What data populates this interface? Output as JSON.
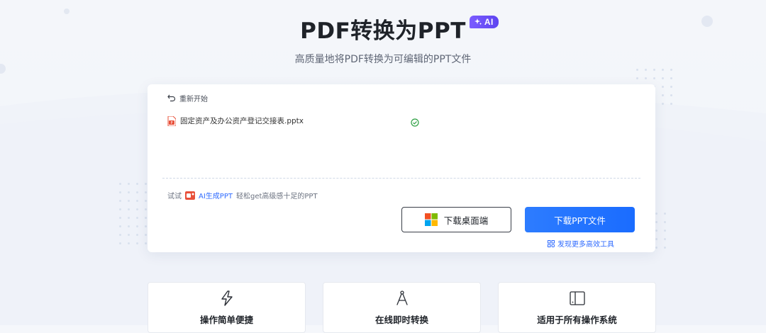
{
  "header": {
    "title": "PDF转换为PPT",
    "ai_badge": "AI",
    "subtitle": "高质量地将PDF转换为可编辑的PPT文件"
  },
  "converter": {
    "restart_label": "重新开始",
    "file": {
      "name": "固定资产及办公资产登记交接表.pptx",
      "status": "done"
    },
    "try_prefix": "试试",
    "try_link": "AI生成PPT",
    "try_suffix": "轻松get高级感十足的PPT",
    "download_desktop_label": "下载桌面端",
    "download_file_label": "下载PPT文件",
    "more_tools_label": "发现更多高效工具"
  },
  "features": [
    {
      "label": "操作简单便捷",
      "icon": "lightning-icon"
    },
    {
      "label": "在线即时转换",
      "icon": "compass-icon"
    },
    {
      "label": "适用于所有操作系统",
      "icon": "devices-icon"
    }
  ],
  "colors": {
    "accent": "#1a6cff",
    "ai_badge": "#6a4ff5",
    "success": "#2ea043",
    "file_icon": "#e8503a"
  }
}
